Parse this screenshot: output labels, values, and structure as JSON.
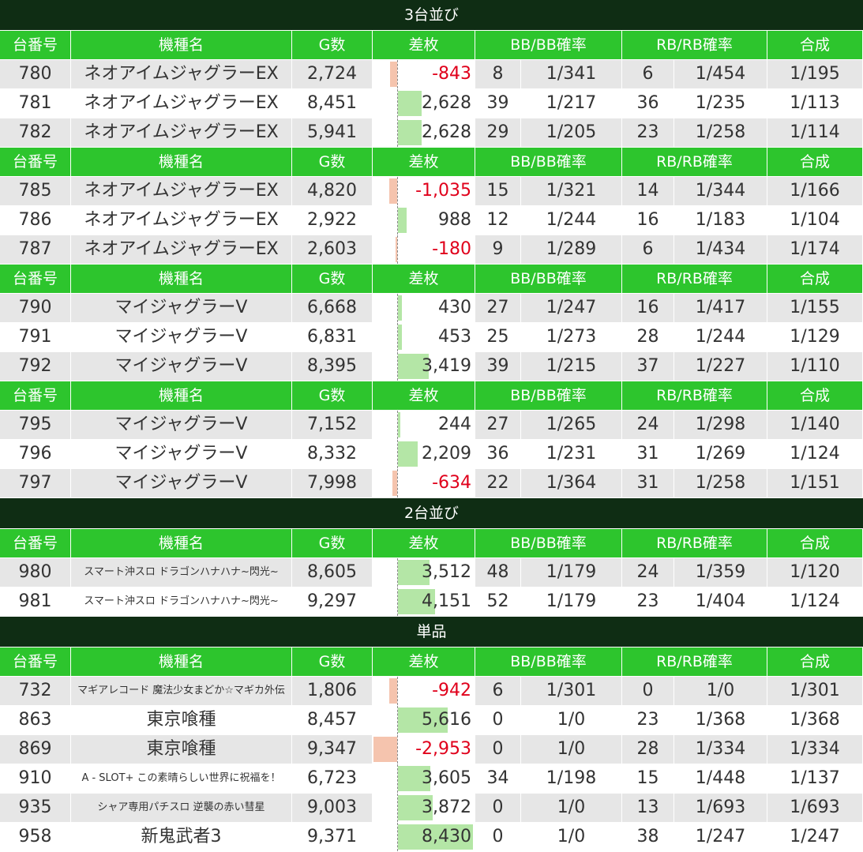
{
  "headers": {
    "id": "台番号",
    "model": "機種名",
    "games": "G数",
    "diff": "差枚",
    "bb": "BB/BB確率",
    "rb": "RB/RB確率",
    "combo": "合成"
  },
  "sections": [
    {
      "title": "3台並び",
      "groups": [
        [
          {
            "id": "780",
            "model": "ネオアイムジャグラーEX",
            "games": "2,724",
            "diff": -843,
            "diff_text": "-843",
            "bb": "8",
            "bb_prob": "1/341",
            "rb": "6",
            "rb_prob": "1/454",
            "combo": "1/195"
          },
          {
            "id": "781",
            "model": "ネオアイムジャグラーEX",
            "games": "8,451",
            "diff": 2628,
            "diff_text": "2,628",
            "bb": "39",
            "bb_prob": "1/217",
            "rb": "36",
            "rb_prob": "1/235",
            "combo": "1/113"
          },
          {
            "id": "782",
            "model": "ネオアイムジャグラーEX",
            "games": "5,941",
            "diff": 2628,
            "diff_text": "2,628",
            "bb": "29",
            "bb_prob": "1/205",
            "rb": "23",
            "rb_prob": "1/258",
            "combo": "1/114"
          }
        ],
        [
          {
            "id": "785",
            "model": "ネオアイムジャグラーEX",
            "games": "4,820",
            "diff": -1035,
            "diff_text": "-1,035",
            "bb": "15",
            "bb_prob": "1/321",
            "rb": "14",
            "rb_prob": "1/344",
            "combo": "1/166"
          },
          {
            "id": "786",
            "model": "ネオアイムジャグラーEX",
            "games": "2,922",
            "diff": 988,
            "diff_text": "988",
            "bb": "12",
            "bb_prob": "1/244",
            "rb": "16",
            "rb_prob": "1/183",
            "combo": "1/104"
          },
          {
            "id": "787",
            "model": "ネオアイムジャグラーEX",
            "games": "2,603",
            "diff": -180,
            "diff_text": "-180",
            "bb": "9",
            "bb_prob": "1/289",
            "rb": "6",
            "rb_prob": "1/434",
            "combo": "1/174"
          }
        ],
        [
          {
            "id": "790",
            "model": "マイジャグラーV",
            "games": "6,668",
            "diff": 430,
            "diff_text": "430",
            "bb": "27",
            "bb_prob": "1/247",
            "rb": "16",
            "rb_prob": "1/417",
            "combo": "1/155"
          },
          {
            "id": "791",
            "model": "マイジャグラーV",
            "games": "6,831",
            "diff": 453,
            "diff_text": "453",
            "bb": "25",
            "bb_prob": "1/273",
            "rb": "28",
            "rb_prob": "1/244",
            "combo": "1/129"
          },
          {
            "id": "792",
            "model": "マイジャグラーV",
            "games": "8,395",
            "diff": 3419,
            "diff_text": "3,419",
            "bb": "39",
            "bb_prob": "1/215",
            "rb": "37",
            "rb_prob": "1/227",
            "combo": "1/110"
          }
        ],
        [
          {
            "id": "795",
            "model": "マイジャグラーV",
            "games": "7,152",
            "diff": 244,
            "diff_text": "244",
            "bb": "27",
            "bb_prob": "1/265",
            "rb": "24",
            "rb_prob": "1/298",
            "combo": "1/140"
          },
          {
            "id": "796",
            "model": "マイジャグラーV",
            "games": "8,332",
            "diff": 2209,
            "diff_text": "2,209",
            "bb": "36",
            "bb_prob": "1/231",
            "rb": "31",
            "rb_prob": "1/269",
            "combo": "1/124"
          },
          {
            "id": "797",
            "model": "マイジャグラーV",
            "games": "7,998",
            "diff": -634,
            "diff_text": "-634",
            "bb": "22",
            "bb_prob": "1/364",
            "rb": "31",
            "rb_prob": "1/258",
            "combo": "1/151"
          }
        ]
      ]
    },
    {
      "title": "2台並び",
      "groups": [
        [
          {
            "id": "980",
            "model": "スマート沖スロ ドラゴンハナハナ~閃光~",
            "size": "small",
            "games": "8,605",
            "diff": 3512,
            "diff_text": "3,512",
            "bb": "48",
            "bb_prob": "1/179",
            "rb": "24",
            "rb_prob": "1/359",
            "combo": "1/120"
          },
          {
            "id": "981",
            "model": "スマート沖スロ ドラゴンハナハナ~閃光~",
            "size": "small",
            "games": "9,297",
            "diff": 4151,
            "diff_text": "4,151",
            "bb": "52",
            "bb_prob": "1/179",
            "rb": "23",
            "rb_prob": "1/404",
            "combo": "1/124"
          }
        ]
      ]
    },
    {
      "title": "単品",
      "groups": [
        [
          {
            "id": "732",
            "model": "マギアレコード 魔法少女まどか☆マギカ外伝",
            "size": "small",
            "games": "1,806",
            "diff": -942,
            "diff_text": "-942",
            "bb": "6",
            "bb_prob": "1/301",
            "rb": "0",
            "rb_prob": "1/0",
            "combo": "1/301"
          },
          {
            "id": "863",
            "model": "東京喰種",
            "games": "8,457",
            "diff": 5616,
            "diff_text": "5,616",
            "bb": "0",
            "bb_prob": "1/0",
            "rb": "23",
            "rb_prob": "1/368",
            "combo": "1/368"
          },
          {
            "id": "869",
            "model": "東京喰種",
            "games": "9,347",
            "diff": -2953,
            "diff_text": "-2,953",
            "bb": "0",
            "bb_prob": "1/0",
            "rb": "28",
            "rb_prob": "1/334",
            "combo": "1/334"
          },
          {
            "id": "910",
            "model": "A - SLOT+ この素晴らしい世界に祝福を！",
            "size": "small",
            "games": "6,723",
            "diff": 3605,
            "diff_text": "3,605",
            "bb": "34",
            "bb_prob": "1/198",
            "rb": "15",
            "rb_prob": "1/448",
            "combo": "1/137"
          },
          {
            "id": "935",
            "model": "シャア専用パチスロ 逆襲の赤い彗星",
            "size": "small",
            "games": "9,003",
            "diff": 3872,
            "diff_text": "3,872",
            "bb": "0",
            "bb_prob": "1/0",
            "rb": "13",
            "rb_prob": "1/693",
            "combo": "1/693"
          },
          {
            "id": "958",
            "model": "新鬼武者3",
            "games": "9,371",
            "diff": 8430,
            "diff_text": "8,430",
            "bb": "0",
            "bb_prob": "1/0",
            "rb": "38",
            "rb_prob": "1/247",
            "combo": "1/247"
          }
        ]
      ]
    }
  ],
  "diff_scale": {
    "max_positive": 8430,
    "max_negative": 2953
  },
  "colors": {
    "section_bg": "#0f2d14",
    "header_bg": "#2dc52d",
    "row_alt": "#e6e6e6",
    "bar_positive": "#b4e6a6",
    "bar_negative": "#f5c4ae",
    "negative_text": "#e0001b"
  }
}
